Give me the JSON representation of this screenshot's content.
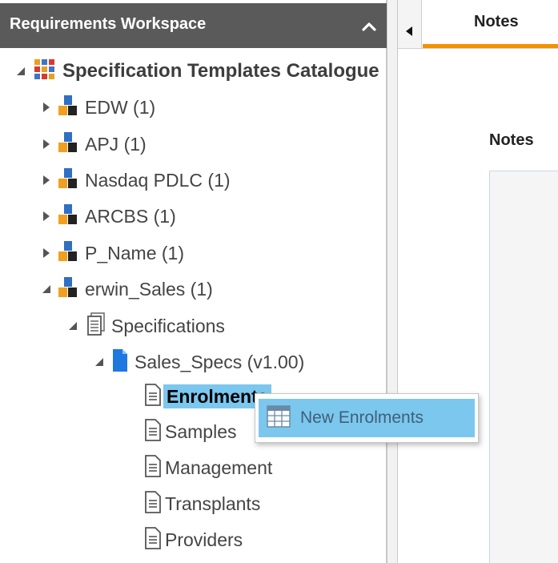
{
  "workspace": {
    "title": "Requirements Workspace",
    "collapse_icon": "chevron-up-icon"
  },
  "tree": {
    "root": {
      "label": "Specification Templates Catalogue",
      "icon": "catalogue-grid-icon",
      "expanded": true
    },
    "projects": [
      {
        "label": "EDW (1)",
        "icon": "project-icon",
        "expanded": false
      },
      {
        "label": "APJ (1)",
        "icon": "project-icon",
        "expanded": false
      },
      {
        "label": "Nasdaq PDLC (1)",
        "icon": "project-icon",
        "expanded": false
      },
      {
        "label": "ARCBS (1)",
        "icon": "project-icon",
        "expanded": false
      },
      {
        "label": "P_Name (1)",
        "icon": "project-icon",
        "expanded": false
      },
      {
        "label": "erwin_Sales (1)",
        "icon": "project-icon",
        "expanded": true
      }
    ],
    "specifications": {
      "label": "Specifications",
      "icon": "specifications-icon",
      "expanded": true
    },
    "spec": {
      "label": "Sales_Specs (v1.00)",
      "icon": "spec-document-icon",
      "expanded": true
    },
    "sections": [
      {
        "label": "Enrolments",
        "icon": "document-icon",
        "selected": true
      },
      {
        "label": "Samples",
        "icon": "document-icon",
        "selected": false
      },
      {
        "label": "Management",
        "icon": "document-icon",
        "selected": false
      },
      {
        "label": "Transplants",
        "icon": "document-icon",
        "selected": false
      },
      {
        "label": "Providers",
        "icon": "document-icon",
        "selected": false
      }
    ]
  },
  "context_menu": {
    "items": [
      {
        "label": "New Enrolments",
        "icon": "table-icon"
      }
    ]
  },
  "right_pane": {
    "tab_label": "Notes",
    "notes_label": "Notes",
    "notes_value": "",
    "accent_color": "#f39200"
  },
  "colors": {
    "header_bg": "#5a5a5a",
    "selection_bg": "#7cc7ee"
  }
}
